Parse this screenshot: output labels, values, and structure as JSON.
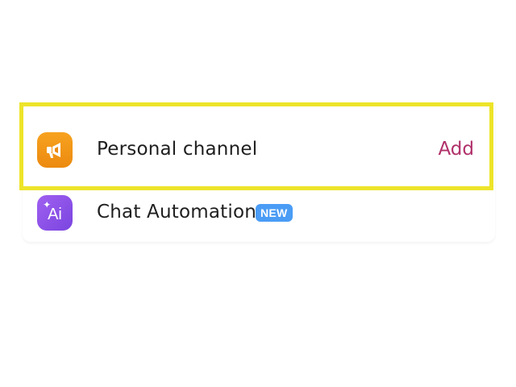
{
  "settings_list": {
    "items": [
      {
        "label": "Personal channel",
        "action_label": "Add",
        "icon": "megaphone-icon",
        "icon_color": "#F39A18"
      },
      {
        "label": "Chat Automation",
        "badge": "NEW",
        "icon": "ai-sparkle-icon",
        "icon_glyph": "Ai",
        "icon_color": "#8B50E8"
      }
    ]
  },
  "colors": {
    "highlight": "#EDE42A",
    "action": "#B0306A",
    "badge": "#4A9CF5"
  }
}
